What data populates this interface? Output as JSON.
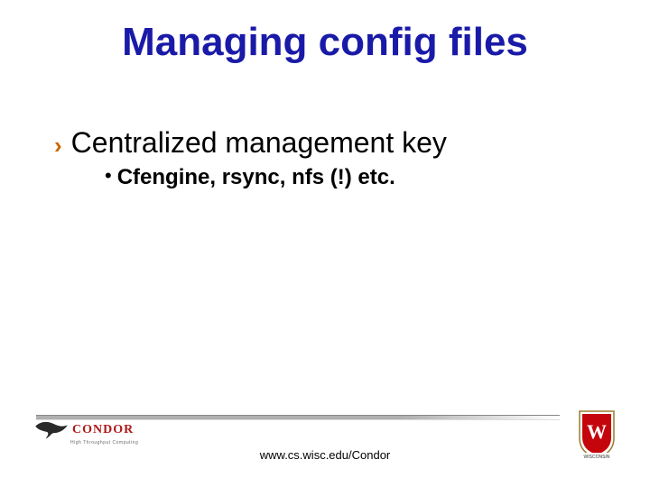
{
  "title": "Managing config files",
  "bullets": [
    {
      "text": "Centralized management key",
      "sub": [
        {
          "text": "Cfengine, rsync, nfs (!) etc."
        }
      ]
    }
  ],
  "footer": {
    "url": "www.cs.wisc.edu/Condor"
  },
  "logos": {
    "condor_text": "CONDOR",
    "condor_sub": "High Throughput Computing",
    "wisconsin": "WISCONSIN"
  },
  "colors": {
    "title": "#1a1aa8",
    "bullet_marker": "#cc6600",
    "condor_red": "#b01818",
    "wisc_red": "#c5050c"
  }
}
